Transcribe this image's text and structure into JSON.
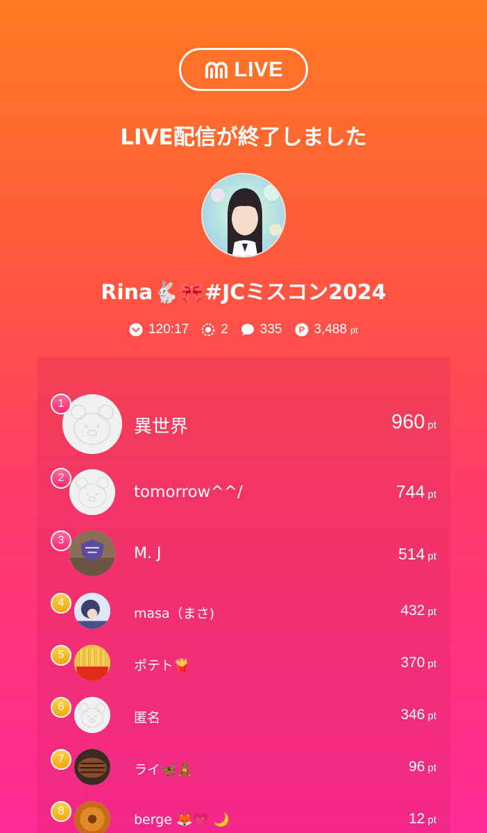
{
  "brand": {
    "text": "LIVE",
    "icon": "m-logo-icon"
  },
  "title": "LIVE配信が終了しました",
  "streamer": {
    "name": "Rina🐇🎀#JCミスコン2024"
  },
  "stats": {
    "duration": "120:17",
    "viewers": "2",
    "comments": "335",
    "points": "3,488",
    "points_unit": "pt"
  },
  "ranking": [
    {
      "rank": "1",
      "name": "異世界",
      "score": "960",
      "unit": "pt",
      "avatar": "bear-default"
    },
    {
      "rank": "2",
      "name": "tomorrow^^/",
      "score": "744",
      "unit": "pt",
      "avatar": "bear-default"
    },
    {
      "rank": "3",
      "name": "M. J",
      "score": "514",
      "unit": "pt",
      "avatar": "photo"
    },
    {
      "rank": "4",
      "name": "masa（まさ)",
      "score": "432",
      "unit": "pt",
      "avatar": "photo"
    },
    {
      "rank": "5",
      "name": "ポテト🍟",
      "score": "370",
      "unit": "pt",
      "avatar": "fries"
    },
    {
      "rank": "6",
      "name": "匿名",
      "score": "346",
      "unit": "pt",
      "avatar": "bear-default"
    },
    {
      "rank": "7",
      "name": "ライ🦋🧸",
      "score": "96",
      "unit": "pt",
      "avatar": "steak"
    },
    {
      "rank": "8",
      "name": "berge 🦊💗 🌙",
      "score": "12",
      "unit": "pt",
      "avatar": "donut"
    }
  ]
}
